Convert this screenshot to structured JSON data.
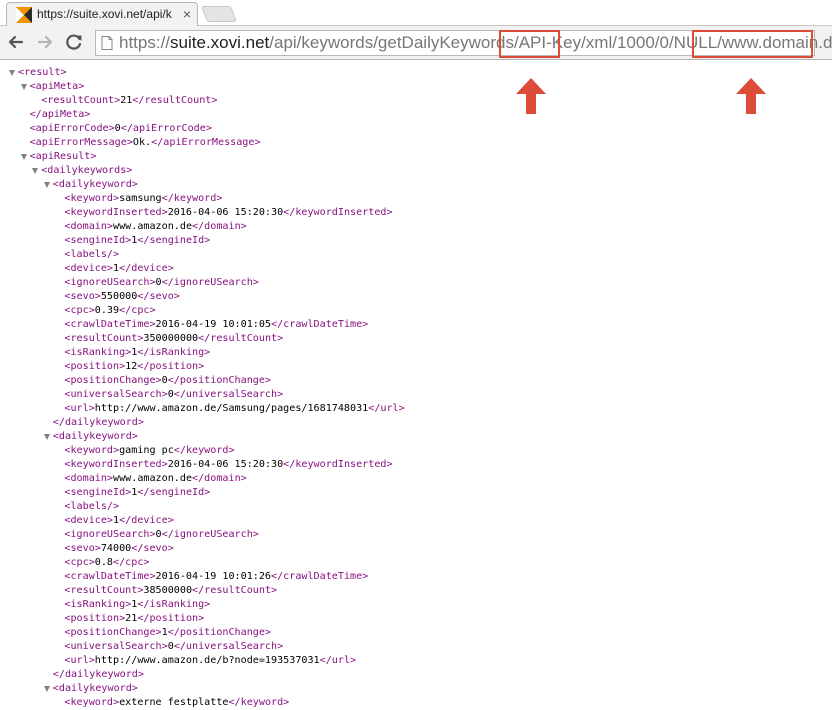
{
  "tab": {
    "title": "https://suite.xovi.net/api/k",
    "close": "×"
  },
  "toolbar": {
    "back_icon": "arrow-left-icon",
    "forward_icon": "arrow-right-icon",
    "reload_icon": "reload-icon"
  },
  "address": {
    "scheme": "https://",
    "host": "suite.xovi.net",
    "path1": "/api/keywords/getDailyKeywords/",
    "apikey": "API-Key",
    "path2": "/xml/1000/0/NULL/",
    "domain": "www.domain.de"
  },
  "annotations": {
    "color": "#dd4b39"
  },
  "xml_lines": [
    {
      "d": 0,
      "t": true,
      "tag": "<result>",
      "text": "",
      "close": ""
    },
    {
      "d": 1,
      "t": true,
      "tag": "<apiMeta>",
      "text": "",
      "close": ""
    },
    {
      "d": 2,
      "t": false,
      "tag": "<resultCount>",
      "text": "21",
      "close": "</resultCount>"
    },
    {
      "d": 1,
      "t": false,
      "tag": "</apiMeta>",
      "text": "",
      "close": ""
    },
    {
      "d": 1,
      "t": false,
      "tag": "<apiErrorCode>",
      "text": "0",
      "close": "</apiErrorCode>"
    },
    {
      "d": 1,
      "t": false,
      "tag": "<apiErrorMessage>",
      "text": "Ok.",
      "close": "</apiErrorMessage>"
    },
    {
      "d": 1,
      "t": true,
      "tag": "<apiResult>",
      "text": "",
      "close": ""
    },
    {
      "d": 2,
      "t": true,
      "tag": "<dailykeywords>",
      "text": "",
      "close": ""
    },
    {
      "d": 3,
      "t": true,
      "tag": "<dailykeyword>",
      "text": "",
      "close": ""
    },
    {
      "d": 4,
      "t": false,
      "tag": "<keyword>",
      "text": "samsung",
      "close": "</keyword>"
    },
    {
      "d": 4,
      "t": false,
      "tag": "<keywordInserted>",
      "text": "2016-04-06 15:20:30",
      "close": "</keywordInserted>"
    },
    {
      "d": 4,
      "t": false,
      "tag": "<domain>",
      "text": "www.amazon.de",
      "close": "</domain>"
    },
    {
      "d": 4,
      "t": false,
      "tag": "<sengineId>",
      "text": "1",
      "close": "</sengineId>"
    },
    {
      "d": 4,
      "t": false,
      "tag": "<labels/>",
      "text": "",
      "close": ""
    },
    {
      "d": 4,
      "t": false,
      "tag": "<device>",
      "text": "1",
      "close": "</device>"
    },
    {
      "d": 4,
      "t": false,
      "tag": "<ignoreUSearch>",
      "text": "0",
      "close": "</ignoreUSearch>"
    },
    {
      "d": 4,
      "t": false,
      "tag": "<sevo>",
      "text": "550000",
      "close": "</sevo>"
    },
    {
      "d": 4,
      "t": false,
      "tag": "<cpc>",
      "text": "0.39",
      "close": "</cpc>"
    },
    {
      "d": 4,
      "t": false,
      "tag": "<crawlDateTime>",
      "text": "2016-04-19 10:01:05",
      "close": "</crawlDateTime>"
    },
    {
      "d": 4,
      "t": false,
      "tag": "<resultCount>",
      "text": "350000000",
      "close": "</resultCount>"
    },
    {
      "d": 4,
      "t": false,
      "tag": "<isRanking>",
      "text": "1",
      "close": "</isRanking>"
    },
    {
      "d": 4,
      "t": false,
      "tag": "<position>",
      "text": "12",
      "close": "</position>"
    },
    {
      "d": 4,
      "t": false,
      "tag": "<positionChange>",
      "text": "0",
      "close": "</positionChange>"
    },
    {
      "d": 4,
      "t": false,
      "tag": "<universalSearch>",
      "text": "0",
      "close": "</universalSearch>"
    },
    {
      "d": 4,
      "t": false,
      "tag": "<url>",
      "text": "http://www.amazon.de/Samsung/pages/1681748031",
      "close": "</url>"
    },
    {
      "d": 3,
      "t": false,
      "tag": "</dailykeyword>",
      "text": "",
      "close": ""
    },
    {
      "d": 3,
      "t": true,
      "tag": "<dailykeyword>",
      "text": "",
      "close": ""
    },
    {
      "d": 4,
      "t": false,
      "tag": "<keyword>",
      "text": "gaming pc",
      "close": "</keyword>"
    },
    {
      "d": 4,
      "t": false,
      "tag": "<keywordInserted>",
      "text": "2016-04-06 15:20:30",
      "close": "</keywordInserted>"
    },
    {
      "d": 4,
      "t": false,
      "tag": "<domain>",
      "text": "www.amazon.de",
      "close": "</domain>"
    },
    {
      "d": 4,
      "t": false,
      "tag": "<sengineId>",
      "text": "1",
      "close": "</sengineId>"
    },
    {
      "d": 4,
      "t": false,
      "tag": "<labels/>",
      "text": "",
      "close": ""
    },
    {
      "d": 4,
      "t": false,
      "tag": "<device>",
      "text": "1",
      "close": "</device>"
    },
    {
      "d": 4,
      "t": false,
      "tag": "<ignoreUSearch>",
      "text": "0",
      "close": "</ignoreUSearch>"
    },
    {
      "d": 4,
      "t": false,
      "tag": "<sevo>",
      "text": "74000",
      "close": "</sevo>"
    },
    {
      "d": 4,
      "t": false,
      "tag": "<cpc>",
      "text": "0.8",
      "close": "</cpc>"
    },
    {
      "d": 4,
      "t": false,
      "tag": "<crawlDateTime>",
      "text": "2016-04-19 10:01:26",
      "close": "</crawlDateTime>"
    },
    {
      "d": 4,
      "t": false,
      "tag": "<resultCount>",
      "text": "38500000",
      "close": "</resultCount>"
    },
    {
      "d": 4,
      "t": false,
      "tag": "<isRanking>",
      "text": "1",
      "close": "</isRanking>"
    },
    {
      "d": 4,
      "t": false,
      "tag": "<position>",
      "text": "21",
      "close": "</position>"
    },
    {
      "d": 4,
      "t": false,
      "tag": "<positionChange>",
      "text": "1",
      "close": "</positionChange>"
    },
    {
      "d": 4,
      "t": false,
      "tag": "<universalSearch>",
      "text": "0",
      "close": "</universalSearch>"
    },
    {
      "d": 4,
      "t": false,
      "tag": "<url>",
      "text": "http://www.amazon.de/b?node=193537031",
      "close": "</url>"
    },
    {
      "d": 3,
      "t": false,
      "tag": "</dailykeyword>",
      "text": "",
      "close": ""
    },
    {
      "d": 3,
      "t": true,
      "tag": "<dailykeyword>",
      "text": "",
      "close": ""
    },
    {
      "d": 4,
      "t": false,
      "tag": "<keyword>",
      "text": "externe festplatte",
      "close": "</keyword>"
    }
  ]
}
